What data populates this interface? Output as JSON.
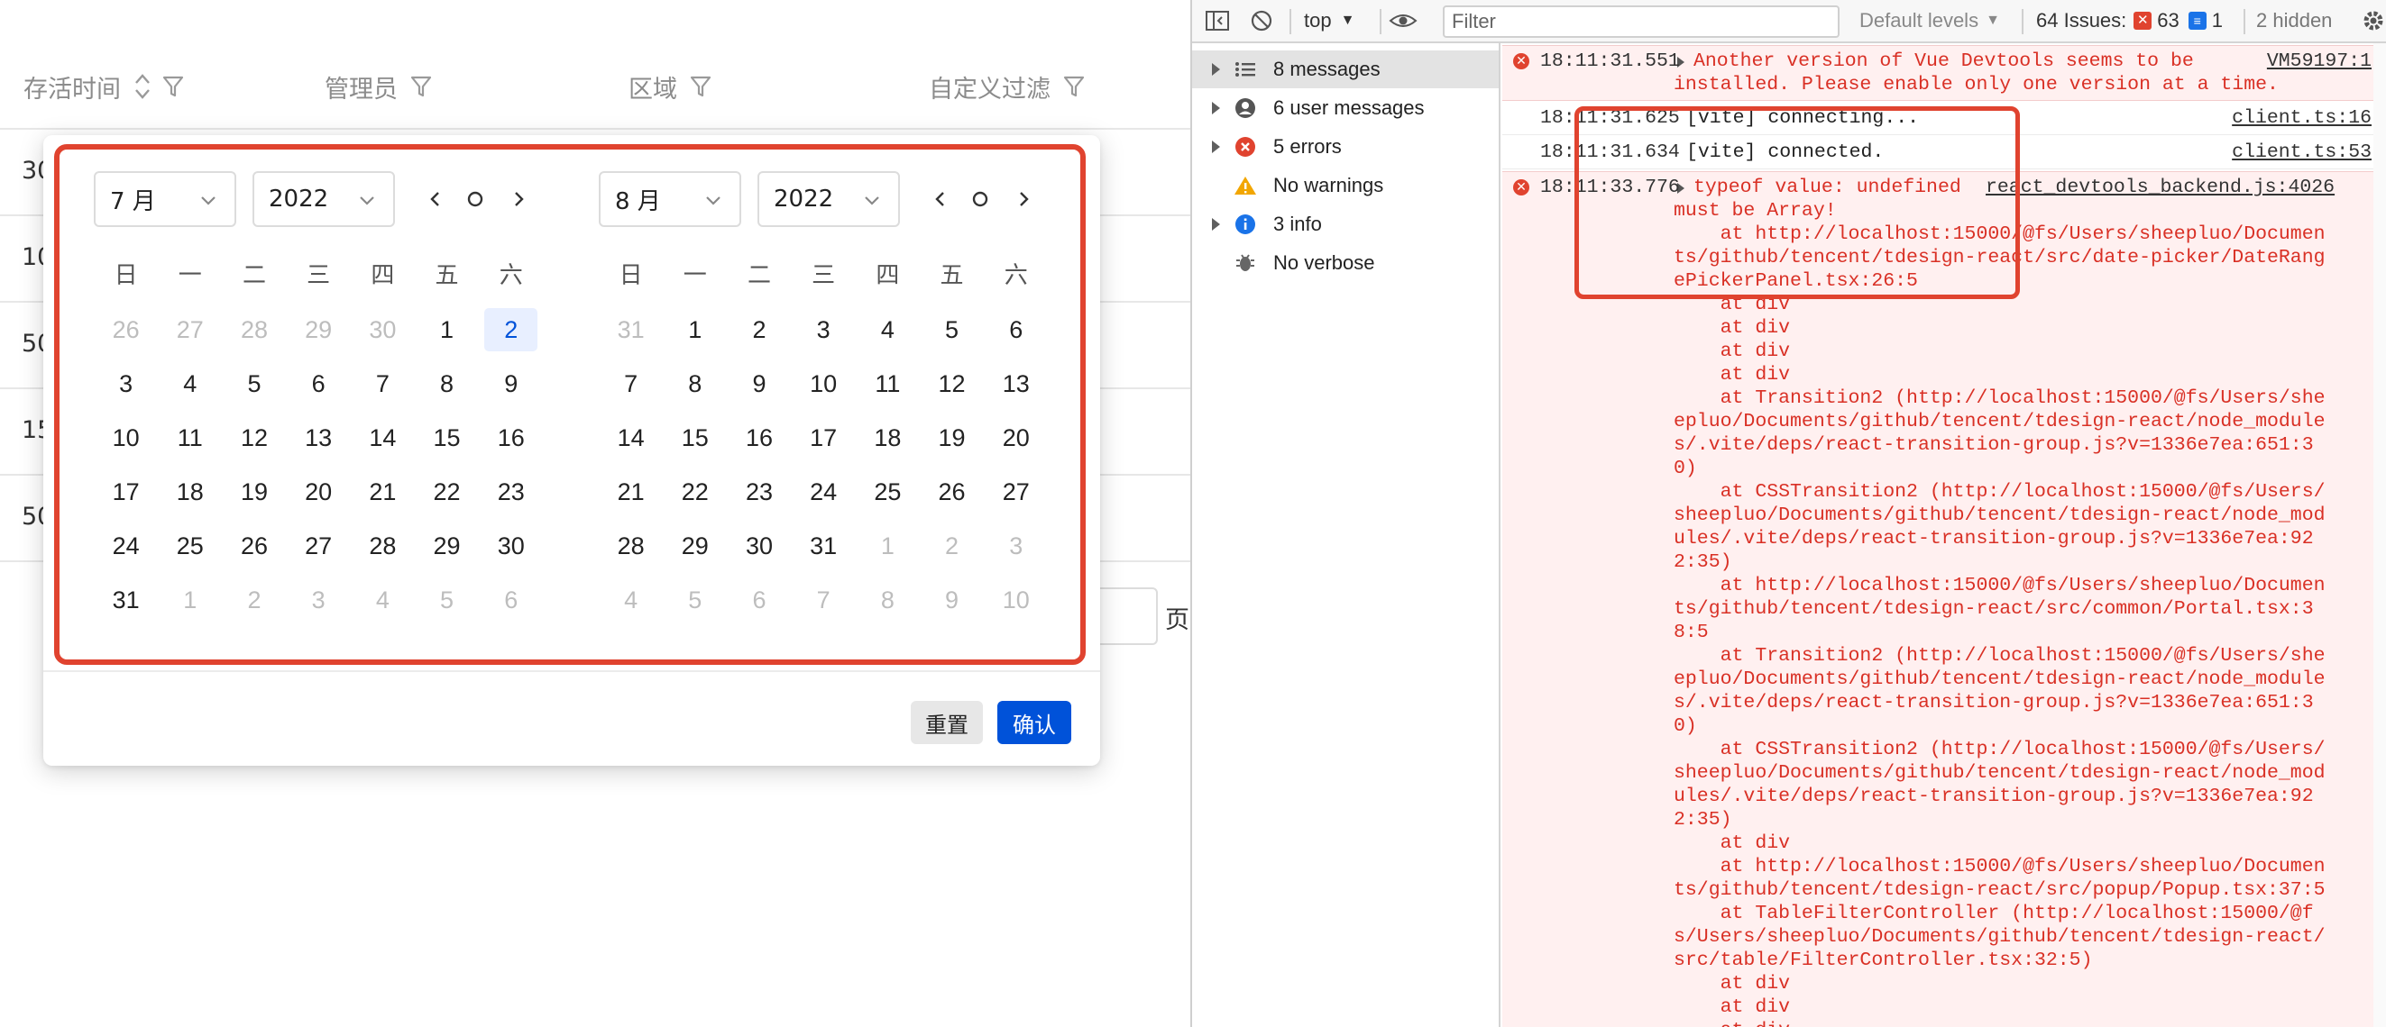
{
  "table": {
    "columns": [
      {
        "label": "存活时间",
        "sortable": true,
        "filter": true
      },
      {
        "label": "管理员",
        "sortable": false,
        "filter": true
      },
      {
        "label": "区域",
        "sortable": false,
        "filter": true
      },
      {
        "label": "自定义过滤",
        "sortable": false,
        "filter": true
      }
    ],
    "row_fragments": [
      "30",
      "10",
      "50",
      "15",
      "50"
    ],
    "page_suffix": "页"
  },
  "date_picker": {
    "left": {
      "month": "7 月",
      "year": "2022",
      "weekdays": [
        "日",
        "一",
        "二",
        "三",
        "四",
        "五",
        "六"
      ],
      "days": [
        {
          "d": "26",
          "other": true
        },
        {
          "d": "27",
          "other": true
        },
        {
          "d": "28",
          "other": true
        },
        {
          "d": "29",
          "other": true
        },
        {
          "d": "30",
          "other": true
        },
        {
          "d": "1"
        },
        {
          "d": "2",
          "selected": true
        },
        {
          "d": "3"
        },
        {
          "d": "4"
        },
        {
          "d": "5"
        },
        {
          "d": "6"
        },
        {
          "d": "7"
        },
        {
          "d": "8"
        },
        {
          "d": "9"
        },
        {
          "d": "10"
        },
        {
          "d": "11"
        },
        {
          "d": "12"
        },
        {
          "d": "13"
        },
        {
          "d": "14"
        },
        {
          "d": "15"
        },
        {
          "d": "16"
        },
        {
          "d": "17"
        },
        {
          "d": "18"
        },
        {
          "d": "19"
        },
        {
          "d": "20"
        },
        {
          "d": "21"
        },
        {
          "d": "22"
        },
        {
          "d": "23"
        },
        {
          "d": "24"
        },
        {
          "d": "25"
        },
        {
          "d": "26"
        },
        {
          "d": "27"
        },
        {
          "d": "28"
        },
        {
          "d": "29"
        },
        {
          "d": "30"
        },
        {
          "d": "31"
        },
        {
          "d": "1",
          "other": true
        },
        {
          "d": "2",
          "other": true
        },
        {
          "d": "3",
          "other": true
        },
        {
          "d": "4",
          "other": true
        },
        {
          "d": "5",
          "other": true
        },
        {
          "d": "6",
          "other": true
        }
      ]
    },
    "right": {
      "month": "8 月",
      "year": "2022",
      "weekdays": [
        "日",
        "一",
        "二",
        "三",
        "四",
        "五",
        "六"
      ],
      "days": [
        {
          "d": "31",
          "other": true
        },
        {
          "d": "1"
        },
        {
          "d": "2"
        },
        {
          "d": "3"
        },
        {
          "d": "4"
        },
        {
          "d": "5"
        },
        {
          "d": "6"
        },
        {
          "d": "7"
        },
        {
          "d": "8"
        },
        {
          "d": "9"
        },
        {
          "d": "10"
        },
        {
          "d": "11"
        },
        {
          "d": "12"
        },
        {
          "d": "13"
        },
        {
          "d": "14"
        },
        {
          "d": "15"
        },
        {
          "d": "16"
        },
        {
          "d": "17"
        },
        {
          "d": "18"
        },
        {
          "d": "19"
        },
        {
          "d": "20"
        },
        {
          "d": "21"
        },
        {
          "d": "22"
        },
        {
          "d": "23"
        },
        {
          "d": "24"
        },
        {
          "d": "25"
        },
        {
          "d": "26"
        },
        {
          "d": "27"
        },
        {
          "d": "28"
        },
        {
          "d": "29"
        },
        {
          "d": "30"
        },
        {
          "d": "31"
        },
        {
          "d": "1",
          "other": true
        },
        {
          "d": "2",
          "other": true
        },
        {
          "d": "3",
          "other": true
        },
        {
          "d": "4",
          "other": true
        },
        {
          "d": "5",
          "other": true
        },
        {
          "d": "6",
          "other": true
        },
        {
          "d": "7",
          "other": true
        },
        {
          "d": "8",
          "other": true
        },
        {
          "d": "9",
          "other": true
        },
        {
          "d": "10",
          "other": true
        }
      ]
    },
    "reset_label": "重置",
    "confirm_label": "确认"
  },
  "devtools": {
    "toolbar": {
      "context": "top",
      "filter_placeholder": "Filter",
      "levels": "Default levels",
      "issues_label": "64 Issues:",
      "issues_errors": "63",
      "issues_info": "1",
      "hidden": "2 hidden"
    },
    "sidebar": [
      {
        "label": "8 messages",
        "icon": "list-icon",
        "arrow": true,
        "active": true
      },
      {
        "label": "6 user messages",
        "icon": "user-icon",
        "arrow": true
      },
      {
        "label": "5 errors",
        "icon": "error-icon",
        "arrow": true
      },
      {
        "label": "No warnings",
        "icon": "warning-icon",
        "arrow": false
      },
      {
        "label": "3 info",
        "icon": "info-icon",
        "arrow": true
      },
      {
        "label": "No verbose",
        "icon": "bug-icon",
        "arrow": false
      }
    ],
    "messages": [
      {
        "ts": "18:11:31.551",
        "type": "error",
        "lines": [
          "Another version of Vue Devtools seems to be",
          "installed. Please enable only one version at a time."
        ],
        "src": "VM59197:1"
      },
      {
        "ts": "18:11:31.625",
        "type": "info",
        "lines": [
          "[vite] connecting..."
        ],
        "src": "client.ts:16"
      },
      {
        "ts": "18:11:31.634",
        "type": "info",
        "lines": [
          "[vite] connected."
        ],
        "src": "client.ts:53"
      },
      {
        "ts": "18:11:33.776",
        "type": "error",
        "src": "react_devtools_backend.js:4026",
        "lines": [
          "typeof value: undefined",
          "must be Array!",
          "    at http://localhost:15000/@fs/Users/sheepluo/Documen",
          "ts/github/tencent/tdesign-react/src/date-picker/DateRang",
          "ePickerPanel.tsx:26:5",
          "    at div",
          "    at div",
          "    at div",
          "    at div",
          "    at Transition2 (http://localhost:15000/@fs/Users/she",
          "epluo/Documents/github/tencent/tdesign-react/node_module",
          "s/.vite/deps/react-transition-group.js?v=1336e7ea:651:3",
          "0)",
          "    at CSSTransition2 (http://localhost:15000/@fs/Users/",
          "sheepluo/Documents/github/tencent/tdesign-react/node_mod",
          "ules/.vite/deps/react-transition-group.js?v=1336e7ea:92",
          "2:35)",
          "    at http://localhost:15000/@fs/Users/sheepluo/Documen",
          "ts/github/tencent/tdesign-react/src/common/Portal.tsx:3",
          "8:5",
          "    at Transition2 (http://localhost:15000/@fs/Users/she",
          "epluo/Documents/github/tencent/tdesign-react/node_module",
          "s/.vite/deps/react-transition-group.js?v=1336e7ea:651:3",
          "0)",
          "    at CSSTransition2 (http://localhost:15000/@fs/Users/",
          "sheepluo/Documents/github/tencent/tdesign-react/node_mod",
          "ules/.vite/deps/react-transition-group.js?v=1336e7ea:92",
          "2:35)",
          "    at div",
          "    at http://localhost:15000/@fs/Users/sheepluo/Documen",
          "ts/github/tencent/tdesign-react/src/popup/Popup.tsx:37:5",
          "    at TableFilterController (http://localhost:15000/@f",
          "s/Users/sheepluo/Documents/github/tencent/tdesign-react/",
          "src/table/FilterController.tsx:32:5)",
          "    at div",
          "    at div",
          "    at div"
        ]
      }
    ]
  },
  "colors": {
    "accent": "#0052d9",
    "highlight": "#e0432f",
    "error_text": "#d93025",
    "selected_bg": "#e8efff"
  }
}
